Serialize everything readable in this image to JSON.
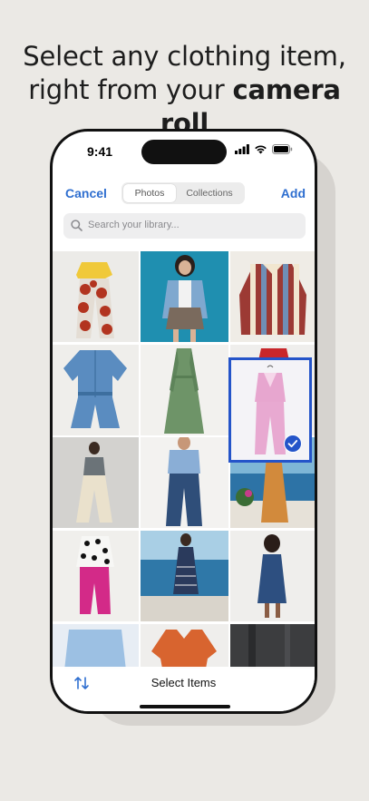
{
  "headline": {
    "line1": "Select any clothing item,",
    "line2_regular": "right from your ",
    "line2_bold": "camera roll"
  },
  "status_bar": {
    "time": "9:41",
    "icons": [
      "signal-icon",
      "wifi-icon",
      "battery-icon"
    ]
  },
  "nav": {
    "cancel_label": "Cancel",
    "add_label": "Add"
  },
  "tabs": [
    {
      "label": "Photos",
      "active": true
    },
    {
      "label": "Collections",
      "active": false
    }
  ],
  "search": {
    "placeholder": "Search your library..."
  },
  "library_grid": {
    "selected_count": 1
  },
  "bottom_bar": {
    "title": "Select Items"
  },
  "colors": {
    "accent": "#2f6fd0",
    "selection": "#2454c9"
  }
}
